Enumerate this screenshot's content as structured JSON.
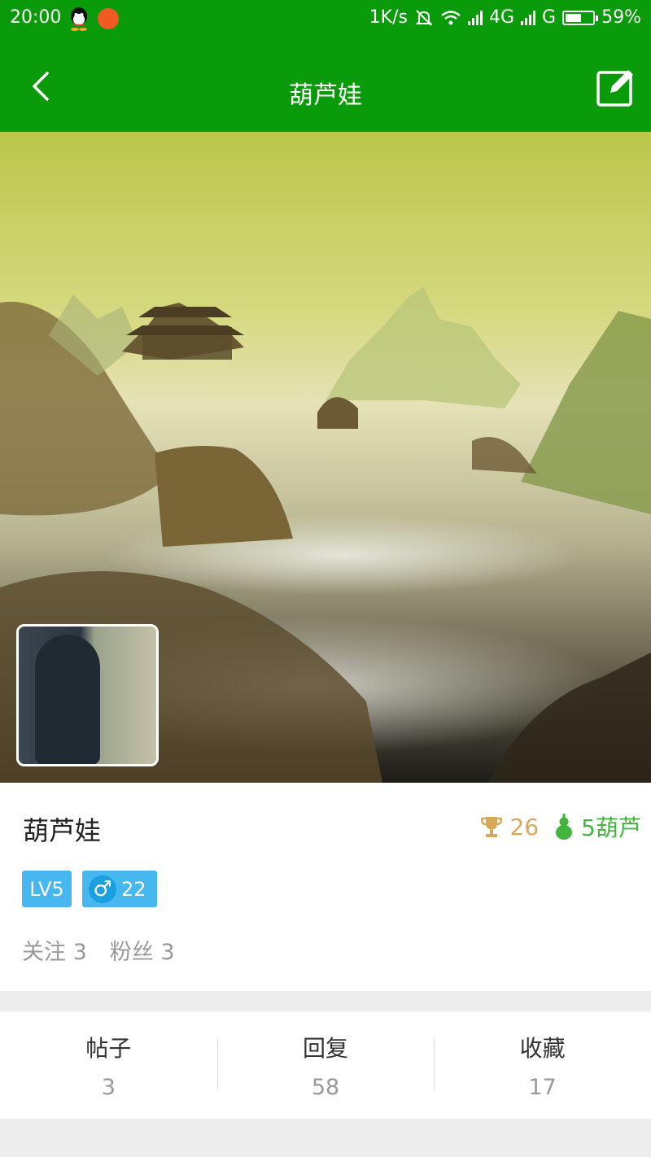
{
  "status": {
    "time": "20:00",
    "speed": "1K/s",
    "net1": "4G",
    "net2": "G",
    "battery_percent": 59,
    "battery_text": "59%"
  },
  "appbar": {
    "title": "葫芦娃"
  },
  "profile": {
    "username": "葫芦娃",
    "score": "26",
    "hulu": "5葫芦",
    "level": "LV5",
    "gender_symbol": "♂",
    "age": "22",
    "follow_label": "关注 3",
    "fans_label": "粉丝 3"
  },
  "counts": [
    {
      "label": "帖子",
      "value": "3"
    },
    {
      "label": "回复",
      "value": "58"
    },
    {
      "label": "收藏",
      "value": "17"
    }
  ],
  "colors": {
    "primary_green": "#0a9b0a",
    "score_gold": "#d7a85a",
    "hulu_green": "#43b53d",
    "badge_blue": "#47b7ef"
  }
}
